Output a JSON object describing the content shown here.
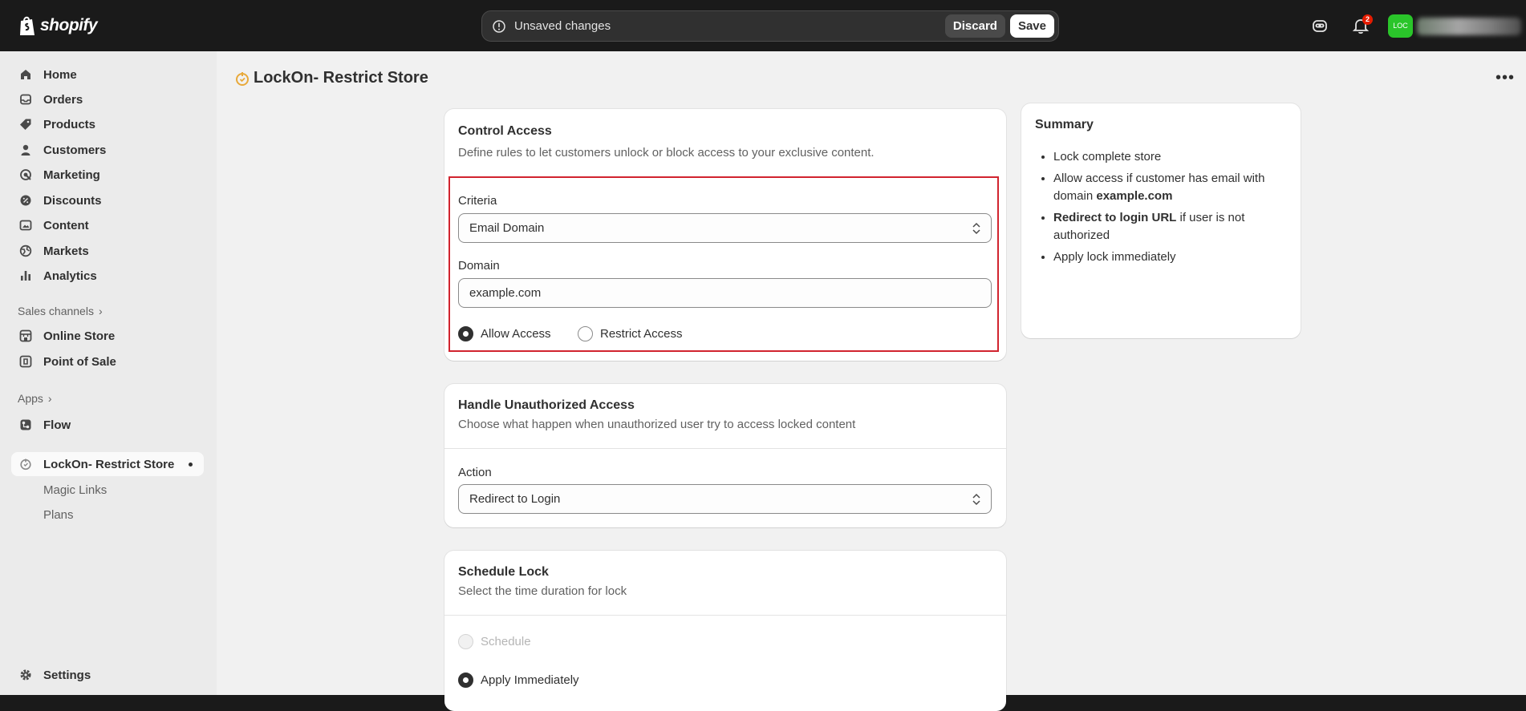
{
  "topbar": {
    "logo_text": "shopify",
    "unsaved_text": "Unsaved changes",
    "discard_label": "Discard",
    "save_label": "Save",
    "notification_count": "2",
    "avatar_initials": "LOC"
  },
  "sidebar": {
    "items": [
      {
        "label": "Home",
        "icon": "home-icon"
      },
      {
        "label": "Orders",
        "icon": "inbox-icon"
      },
      {
        "label": "Products",
        "icon": "tag-icon"
      },
      {
        "label": "Customers",
        "icon": "person-icon"
      },
      {
        "label": "Marketing",
        "icon": "target-icon"
      },
      {
        "label": "Discounts",
        "icon": "discount-icon"
      },
      {
        "label": "Content",
        "icon": "image-icon"
      },
      {
        "label": "Markets",
        "icon": "globe-icon"
      },
      {
        "label": "Analytics",
        "icon": "bar-chart-icon"
      }
    ],
    "sales_channels_label": "Sales channels",
    "channels": [
      {
        "label": "Online Store",
        "icon": "store-icon"
      },
      {
        "label": "Point of Sale",
        "icon": "pos-icon"
      }
    ],
    "apps_label": "Apps",
    "apps": [
      {
        "label": "Flow",
        "icon": "flow-icon"
      },
      {
        "label": "LockOn- Restrict Store",
        "icon": "lockon-icon"
      }
    ],
    "app_subitems": [
      "Magic Links",
      "Plans"
    ],
    "settings_label": "Settings"
  },
  "page": {
    "title": "LockOn- Restrict Store"
  },
  "control_access": {
    "title": "Control Access",
    "description": "Define rules to let customers unlock or block access to your exclusive content.",
    "criteria_label": "Criteria",
    "criteria_value": "Email Domain",
    "domain_label": "Domain",
    "domain_value": "example.com",
    "allow_label": "Allow Access",
    "restrict_label": "Restrict Access"
  },
  "unauthorized": {
    "title": "Handle Unauthorized Access",
    "description": "Choose what happen when unauthorized user try to access locked content",
    "action_label": "Action",
    "action_value": "Redirect to Login"
  },
  "schedule": {
    "title": "Schedule Lock",
    "description": "Select the time duration for lock",
    "schedule_label": "Schedule",
    "immediate_label": "Apply Immediately"
  },
  "summary": {
    "title": "Summary",
    "item1": "Lock complete store",
    "item2_prefix": "Allow access if customer has email with domain ",
    "item2_bold": "example.com",
    "item3_bold": "Redirect to login URL",
    "item3_suffix": " if user is not authorized",
    "item4": "Apply lock immediately"
  }
}
